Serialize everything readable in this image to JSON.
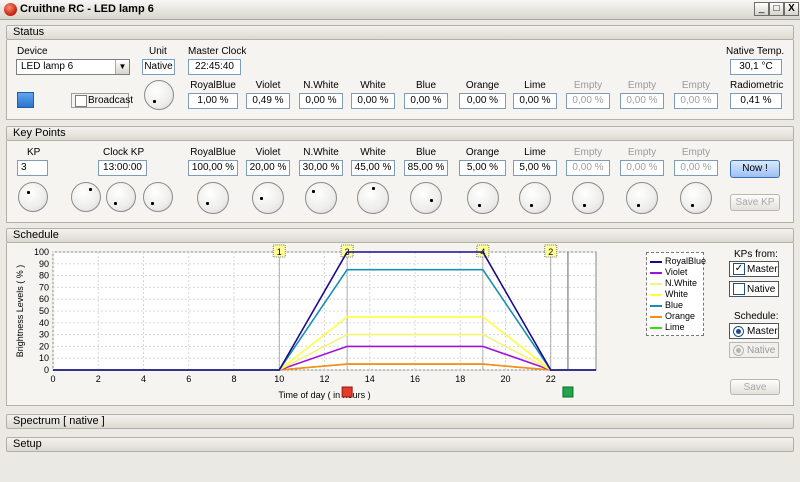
{
  "window": {
    "title": "Cruithne RC  -  LED lamp 6",
    "controls": {
      "minimize": "_",
      "maximize": "□",
      "close": "X"
    }
  },
  "status": {
    "header": "Status",
    "device_label": "Device",
    "device_value": "LED lamp 6",
    "unit_label": "Unit",
    "unit_value": "Native",
    "master_clock_label": "Master Clock",
    "master_clock_value": "22:45:40",
    "native_temp_label": "Native  Temp.",
    "native_temp_value": "30,1 °C",
    "broadcast_label": "Broadcast",
    "radiometric_label": "Radiometric",
    "radiometric_value": "0,41 %",
    "channels": [
      {
        "name": "RoyalBlue",
        "value": "1,00 %",
        "empty": false
      },
      {
        "name": "Violet",
        "value": "0,49 %",
        "empty": false
      },
      {
        "name": "N.White",
        "value": "0,00 %",
        "empty": false
      },
      {
        "name": "White",
        "value": "0,00 %",
        "empty": false
      },
      {
        "name": "Blue",
        "value": "0,00 %",
        "empty": false
      },
      {
        "name": "Orange",
        "value": "0,00 %",
        "empty": false
      },
      {
        "name": "Lime",
        "value": "0,00 %",
        "empty": false
      },
      {
        "name": "Empty",
        "value": "0,00 %",
        "empty": true
      },
      {
        "name": "Empty",
        "value": "0,00 %",
        "empty": true
      },
      {
        "name": "Empty",
        "value": "0,00 %",
        "empty": true
      }
    ]
  },
  "keypoints": {
    "header": "Key Points",
    "kp_label": "KP",
    "kp_value": "3",
    "clock_label": "Clock  KP",
    "clock_value": "13:00:00",
    "now_button": "Now !",
    "save_button": "Save  KP",
    "channels": [
      {
        "name": "RoyalBlue",
        "value": "100,00 %",
        "empty": false
      },
      {
        "name": "Violet",
        "value": "20,00 %",
        "empty": false
      },
      {
        "name": "N.White",
        "value": "30,00 %",
        "empty": false
      },
      {
        "name": "White",
        "value": "45,00 %",
        "empty": false
      },
      {
        "name": "Blue",
        "value": "85,00 %",
        "empty": false
      },
      {
        "name": "Orange",
        "value": "5,00 %",
        "empty": false
      },
      {
        "name": "Lime",
        "value": "5,00 %",
        "empty": false
      },
      {
        "name": "Empty",
        "value": "0,00 %",
        "empty": true
      },
      {
        "name": "Empty",
        "value": "0,00 %",
        "empty": true
      },
      {
        "name": "Empty",
        "value": "0,00 %",
        "empty": true
      }
    ]
  },
  "schedule": {
    "header": "Schedule",
    "kps_from_label": "KPs from:",
    "kps_master_label": "Master",
    "kps_native_label": "Native",
    "schedule_label": "Schedule:",
    "sched_master_label": "Master",
    "sched_native_label": "Native",
    "save_button": "Save",
    "colors": {
      "RoyalBlue": "#1a0a8c",
      "Violet": "#a010d8",
      "N.White": "#f4f47a",
      "White": "#ffff3c",
      "Blue": "#1a8fb4",
      "Orange": "#ff8c1a",
      "Lime": "#3ed81e"
    }
  },
  "spectrum": {
    "header": "Spectrum   [ native ]"
  },
  "setup": {
    "header": "Setup"
  },
  "chart_data": {
    "type": "line",
    "xlabel": "Time of day   ( in hours )",
    "ylabel": "Brightness Levels  ( % )",
    "xlim": [
      0,
      24
    ],
    "ylim": [
      0,
      100
    ],
    "x_ticks": [
      0,
      2,
      4,
      6,
      8,
      10,
      12,
      14,
      16,
      18,
      20,
      22
    ],
    "y_ticks": [
      0,
      10,
      20,
      30,
      40,
      50,
      60,
      70,
      80,
      90,
      100
    ],
    "grid": true,
    "legend": "right",
    "x": [
      0,
      10,
      13,
      19,
      22,
      24
    ],
    "series": [
      {
        "name": "RoyalBlue",
        "values": [
          0,
          0,
          100,
          100,
          0,
          0
        ]
      },
      {
        "name": "Violet",
        "values": [
          0,
          0,
          20,
          20,
          0,
          0
        ]
      },
      {
        "name": "N.White",
        "values": [
          0,
          0,
          30,
          30,
          0,
          0
        ]
      },
      {
        "name": "White",
        "values": [
          0,
          0,
          45,
          45,
          0,
          0
        ]
      },
      {
        "name": "Blue",
        "values": [
          0,
          0,
          85,
          85,
          0,
          0
        ]
      },
      {
        "name": "Orange",
        "values": [
          0,
          0,
          5,
          5,
          0,
          0
        ]
      },
      {
        "name": "Lime",
        "values": [
          0,
          0,
          5,
          5,
          0,
          0
        ]
      }
    ],
    "keypoints": [
      {
        "label": "1",
        "x": 10
      },
      {
        "label": "3",
        "x": 13
      },
      {
        "label": "4",
        "x": 19
      },
      {
        "label": "2",
        "x": 22
      }
    ],
    "current_time": 22.76
  }
}
